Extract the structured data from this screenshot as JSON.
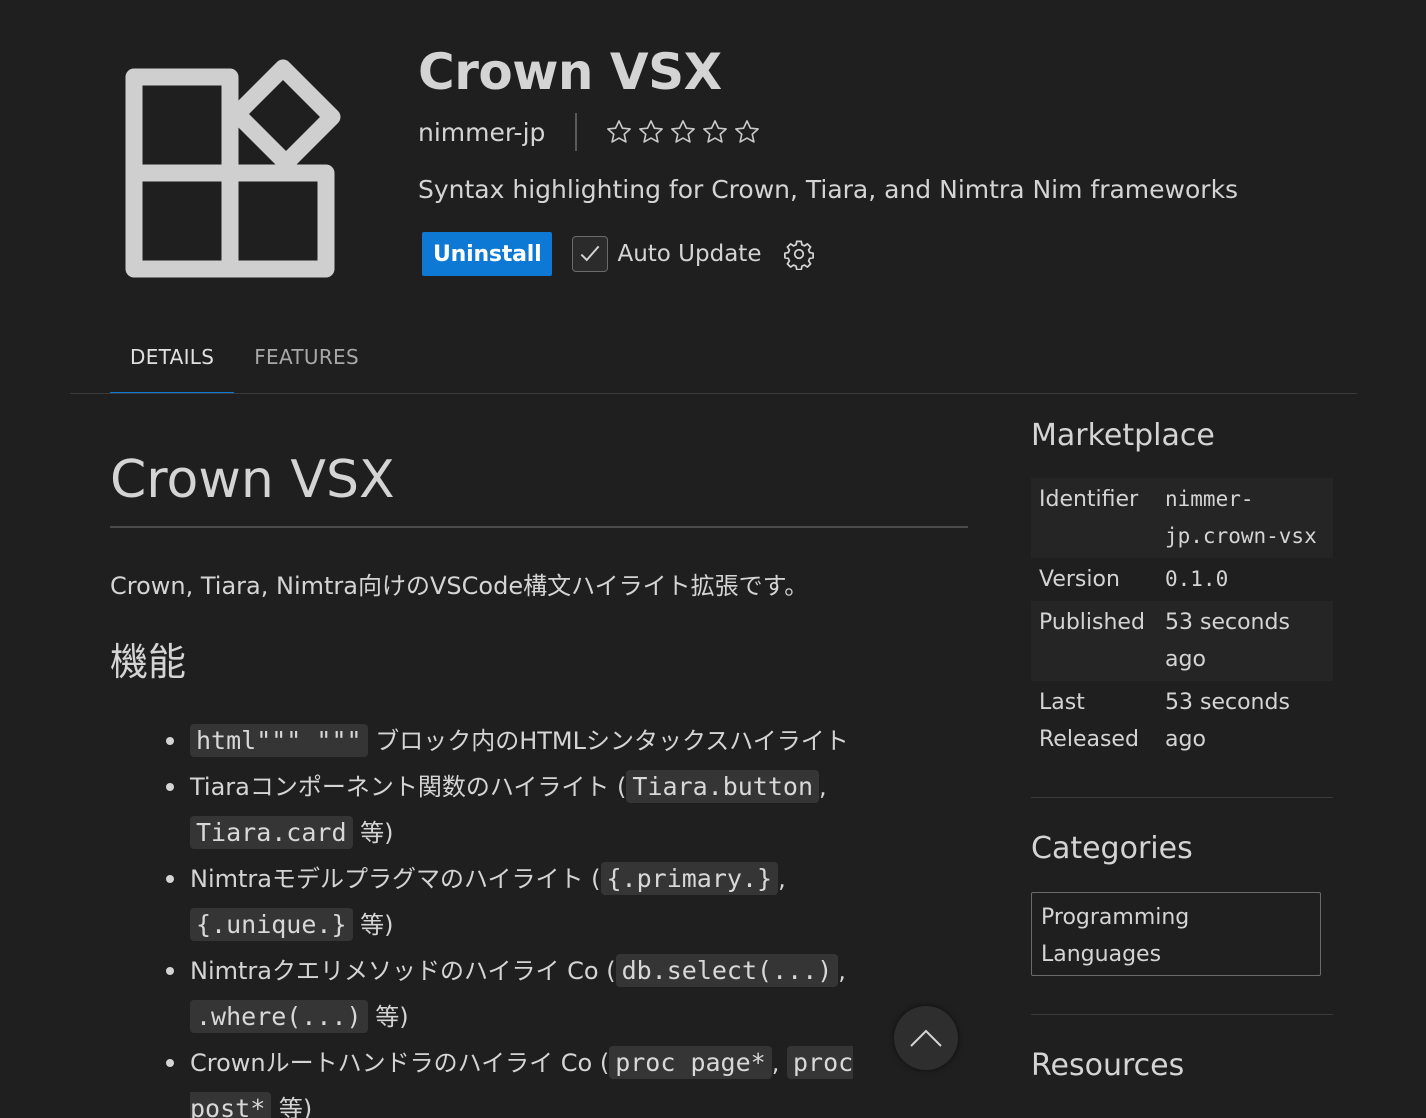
{
  "extension": {
    "name": "Crown VSX",
    "publisher": "nimmer-jp",
    "rating_stars": 5,
    "rating_value": 0,
    "description": "Syntax highlighting for Crown, Tiara, and Nimtra Nim frameworks",
    "uninstall_label": "Uninstall",
    "auto_update_label": "Auto Update",
    "auto_update_checked": true
  },
  "tabs": [
    {
      "label": "DETAILS",
      "active": true
    },
    {
      "label": "FEATURES",
      "active": false
    }
  ],
  "readme": {
    "title": "Crown VSX",
    "intro": "Crown, Tiara, Nimtra向けのVSCode構文ハイライト拡張です。",
    "features_heading": "機能",
    "features": {
      "f1": {
        "code": "html\"\"\" \"\"\"",
        "text": " ブロック内のHTMLシンタックスハイライト"
      },
      "f2": {
        "pre": "Tiaraコンポーネント関数のハイライト (",
        "code1": "Tiara.button",
        "mid": ", ",
        "code2": "Tiara.card",
        "post": " 等)"
      },
      "f3": {
        "pre": "Nimtraモデルプラグマのハイライト (",
        "code1": "{.primary.}",
        "mid": ", ",
        "code2": "{.unique.}",
        "post": " 等)"
      },
      "f4": {
        "pre": "Nimtraクエリメソッドのハイライ Co (",
        "code1": "db.select(...)",
        "mid": ", ",
        "code2": ".where(...)",
        "post": " 等)"
      },
      "f5": {
        "pre": "Crownルートハンドラのハイライ Co (",
        "code1": "proc page*",
        "mid": ", ",
        "code2": "proc post*",
        "post": " 等)"
      }
    }
  },
  "sidebar": {
    "marketplace_heading": "Marketplace",
    "rows": {
      "identifier": {
        "key": "Identifier",
        "value": "nimmer-jp.crown-vsx"
      },
      "version": {
        "key": "Version",
        "value": "0.1.0"
      },
      "published": {
        "key": "Published",
        "value": "53 seconds ago"
      },
      "last_released": {
        "key": "Last Released",
        "value": "53 seconds ago"
      }
    },
    "categories_heading": "Categories",
    "category": "Programming Languages",
    "resources_heading": "Resources"
  },
  "colors": {
    "background": "#1f1f1f",
    "accent": "#0e78d5",
    "text": "#d4d4d4"
  },
  "icons": [
    "extension-logo-icon",
    "star-icon",
    "checkmark-icon",
    "gear-icon",
    "chevron-up-icon"
  ]
}
